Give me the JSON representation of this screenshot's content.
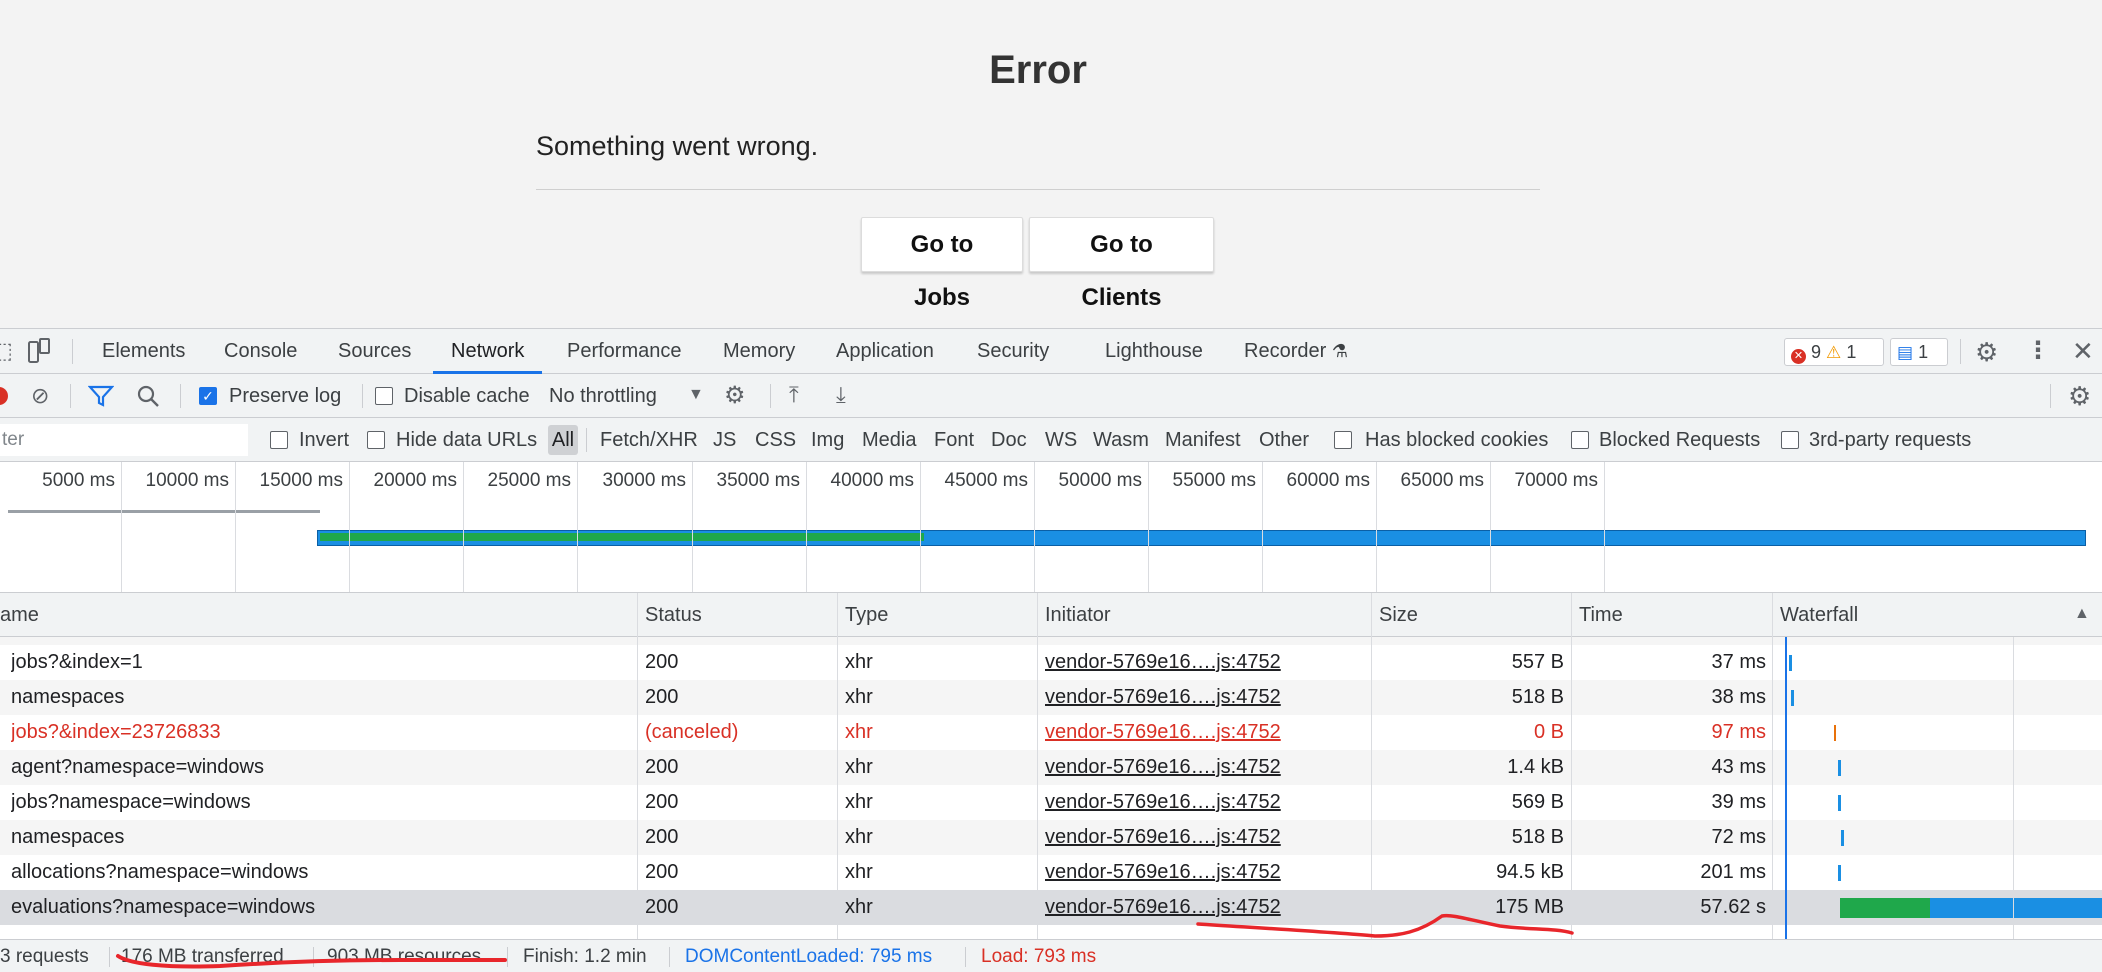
{
  "error_page": {
    "title": "Error",
    "message": "Something went wrong.",
    "buttons": {
      "jobs": "Go to Jobs",
      "clients": "Go to Clients"
    }
  },
  "devtools": {
    "tabs": [
      "Elements",
      "Console",
      "Sources",
      "Network",
      "Performance",
      "Memory",
      "Application",
      "Security",
      "Lighthouse",
      "Recorder"
    ],
    "active_tab": "Network",
    "badges": {
      "errors": "9",
      "warnings": "1",
      "messages": "1"
    },
    "toolbar": {
      "preserve_log": "Preserve log",
      "preserve_log_checked": true,
      "disable_cache": "Disable cache",
      "disable_cache_checked": false,
      "throttling": "No throttling"
    },
    "filter": {
      "value": "ter",
      "invert": "Invert",
      "hide_data_urls": "Hide data URLs",
      "types": [
        "All",
        "Fetch/XHR",
        "JS",
        "CSS",
        "Img",
        "Media",
        "Font",
        "Doc",
        "WS",
        "Wasm",
        "Manifest",
        "Other"
      ],
      "active_type": "All",
      "has_blocked_cookies": "Has blocked cookies",
      "blocked_requests": "Blocked Requests",
      "third_party": "3rd-party requests"
    },
    "overview_ticks": [
      "5000 ms",
      "10000 ms",
      "15000 ms",
      "20000 ms",
      "25000 ms",
      "30000 ms",
      "35000 ms",
      "40000 ms",
      "45000 ms",
      "50000 ms",
      "55000 ms",
      "60000 ms",
      "65000 ms",
      "70000 ms"
    ],
    "columns": {
      "name": "ame",
      "status": "Status",
      "type": "Type",
      "initiator": "Initiator",
      "size": "Size",
      "time": "Time",
      "waterfall": "Waterfall"
    },
    "requests": [
      {
        "name": "jobs?&index=1",
        "status": "200",
        "type": "xhr",
        "initiator": "vendor-5769e16….js:4752",
        "size": "557 B",
        "time": "37 ms",
        "error": false
      },
      {
        "name": "namespaces",
        "status": "200",
        "type": "xhr",
        "initiator": "vendor-5769e16….js:4752",
        "size": "518 B",
        "time": "38 ms",
        "error": false
      },
      {
        "name": "jobs?&index=23726833",
        "status": "(canceled)",
        "type": "xhr",
        "initiator": "vendor-5769e16….js:4752",
        "size": "0 B",
        "time": "97 ms",
        "error": true
      },
      {
        "name": "agent?namespace=windows",
        "status": "200",
        "type": "xhr",
        "initiator": "vendor-5769e16….js:4752",
        "size": "1.4 kB",
        "time": "43 ms",
        "error": false
      },
      {
        "name": "jobs?namespace=windows",
        "status": "200",
        "type": "xhr",
        "initiator": "vendor-5769e16….js:4752",
        "size": "569 B",
        "time": "39 ms",
        "error": false
      },
      {
        "name": "namespaces",
        "status": "200",
        "type": "xhr",
        "initiator": "vendor-5769e16….js:4752",
        "size": "518 B",
        "time": "72 ms",
        "error": false
      },
      {
        "name": "allocations?namespace=windows",
        "status": "200",
        "type": "xhr",
        "initiator": "vendor-5769e16….js:4752",
        "size": "94.5 kB",
        "time": "201 ms",
        "error": false
      },
      {
        "name": "evaluations?namespace=windows",
        "status": "200",
        "type": "xhr",
        "initiator": "vendor-5769e16….js:4752",
        "size": "175 MB",
        "time": "57.62 s",
        "error": false
      }
    ],
    "summary": {
      "requests": "3 requests",
      "transferred": "176 MB transferred",
      "resources": "903 MB resources",
      "finish": "Finish: 1.2 min",
      "dom_content_loaded": "DOMContentLoaded: 795 ms",
      "load": "Load: 793 ms"
    },
    "colors": {
      "accent": "#1a73e8",
      "error": "#d93025",
      "dcl": "#1a73e8",
      "load": "#d93025",
      "wf_green": "#1fa84b",
      "wf_blue": "#1a8fe3",
      "annotation": "#e8262b"
    }
  }
}
